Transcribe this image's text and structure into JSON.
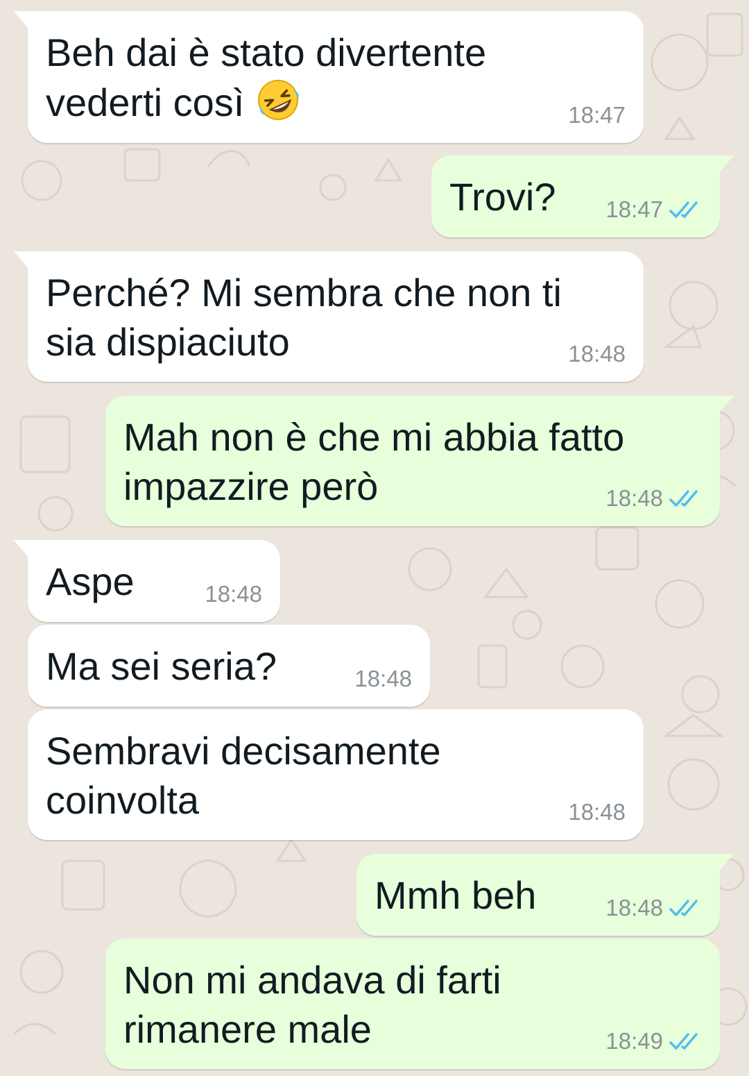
{
  "messages": [
    {
      "id": "m1",
      "direction": "in",
      "tail": true,
      "lines": [
        "Beh dai è stato divertente",
        "vederti così"
      ],
      "emoji": "rolling-on-floor-laughing",
      "time": "18:47"
    },
    {
      "id": "m2",
      "direction": "out",
      "tail": true,
      "lines": [
        "Trovi?"
      ],
      "time": "18:47",
      "status": "read"
    },
    {
      "id": "m3",
      "direction": "in",
      "tail": true,
      "lines": [
        "Perché? Mi sembra che non ti",
        "sia dispiaciuto"
      ],
      "time": "18:48"
    },
    {
      "id": "m4",
      "direction": "out",
      "tail": true,
      "lines": [
        "Mah non è che mi abbia fatto",
        "impazzire però"
      ],
      "time": "18:48",
      "status": "read"
    },
    {
      "id": "m5",
      "direction": "in",
      "tail": true,
      "lines": [
        "Aspe"
      ],
      "time": "18:48"
    },
    {
      "id": "m6",
      "direction": "in",
      "tail": false,
      "lines": [
        "Ma sei seria?"
      ],
      "time": "18:48"
    },
    {
      "id": "m7",
      "direction": "in",
      "tail": false,
      "lines": [
        "Sembravi decisamente",
        "coinvolta"
      ],
      "time": "18:48"
    },
    {
      "id": "m8",
      "direction": "out",
      "tail": true,
      "lines": [
        "Mmh beh"
      ],
      "time": "18:48",
      "status": "read"
    },
    {
      "id": "m9",
      "direction": "out",
      "tail": false,
      "lines": [
        "Non mi andava di farti",
        "rimanere male"
      ],
      "time": "18:49",
      "status": "read"
    }
  ],
  "colors": {
    "wallpaper": "#ece5dd",
    "incoming_bubble": "#ffffff",
    "outgoing_bubble": "#e7ffdb",
    "read_ticks": "#53bdeb",
    "timestamp": "#8a9196"
  },
  "icons": {
    "read_status": "double-check-icon",
    "emoji": "rolling-on-floor-laughing-emoji"
  }
}
